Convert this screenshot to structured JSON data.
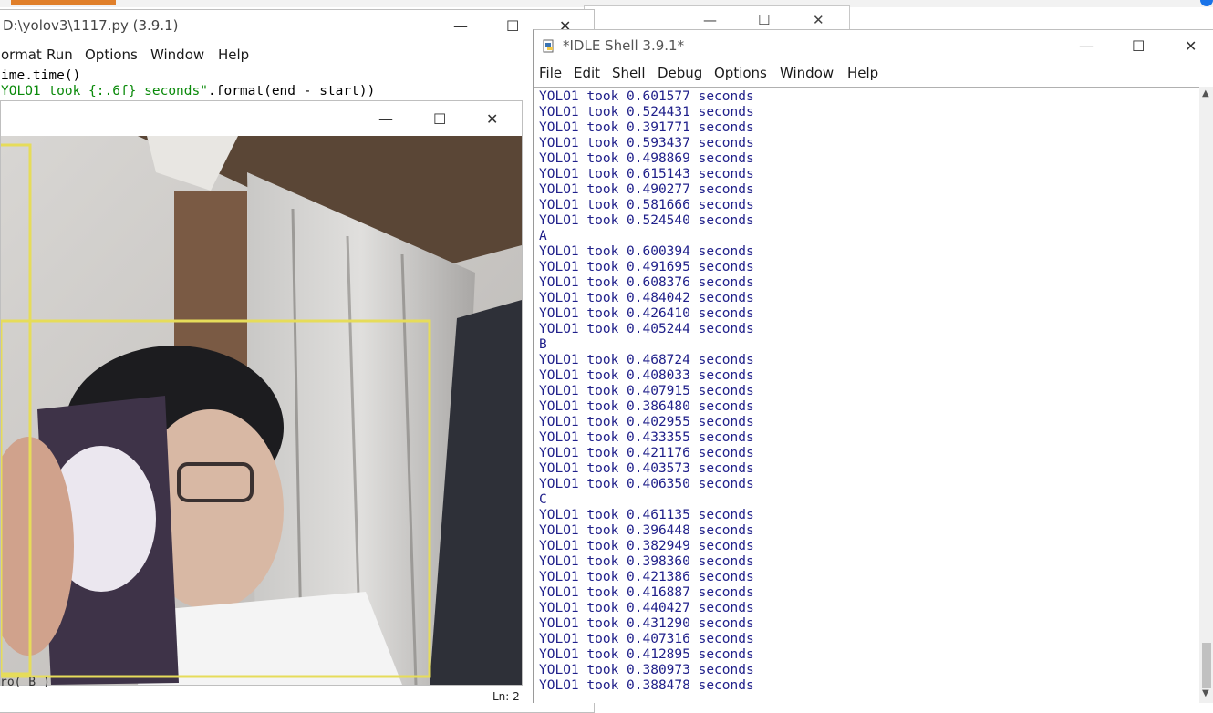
{
  "back_window": {
    "minimize": "—",
    "maximize": "☐",
    "close": "✕"
  },
  "editor": {
    "title": "D:\\yolov3\\1117.py (3.9.1)",
    "menu": [
      "ormat",
      "Run",
      "Options",
      "Window",
      "Help"
    ],
    "code_line1": "ime.time()",
    "code_line2_prefix": "YOLO1 took {:.6f} seconds\"",
    "code_line2_suffix": ".format(end - start))",
    "bottom_text": "ro( B )",
    "status": "Ln: 2"
  },
  "image_window": {
    "minimize": "—",
    "maximize": "☐",
    "close": "✕"
  },
  "shell": {
    "title": "*IDLE Shell 3.9.1*",
    "menu": [
      "File",
      "Edit",
      "Shell",
      "Debug",
      "Options",
      "Window",
      "Help"
    ],
    "lines": [
      "YOLO1 took 0.601577 seconds",
      "YOLO1 took 0.524431 seconds",
      "YOLO1 took 0.391771 seconds",
      "YOLO1 took 0.593437 seconds",
      "YOLO1 took 0.498869 seconds",
      "YOLO1 took 0.615143 seconds",
      "YOLO1 took 0.490277 seconds",
      "YOLO1 took 0.581666 seconds",
      "YOLO1 took 0.524540 seconds",
      "A",
      "YOLO1 took 0.600394 seconds",
      "YOLO1 took 0.491695 seconds",
      "YOLO1 took 0.608376 seconds",
      "YOLO1 took 0.484042 seconds",
      "YOLO1 took 0.426410 seconds",
      "YOLO1 took 0.405244 seconds",
      "B",
      "YOLO1 took 0.468724 seconds",
      "YOLO1 took 0.408033 seconds",
      "YOLO1 took 0.407915 seconds",
      "YOLO1 took 0.386480 seconds",
      "YOLO1 took 0.402955 seconds",
      "YOLO1 took 0.433355 seconds",
      "YOLO1 took 0.421176 seconds",
      "YOLO1 took 0.403573 seconds",
      "YOLO1 took 0.406350 seconds",
      "C",
      "YOLO1 took 0.461135 seconds",
      "YOLO1 took 0.396448 seconds",
      "YOLO1 took 0.382949 seconds",
      "YOLO1 took 0.398360 seconds",
      "YOLO1 took 0.421386 seconds",
      "YOLO1 took 0.416887 seconds",
      "YOLO1 took 0.440427 seconds",
      "YOLO1 took 0.431290 seconds",
      "YOLO1 took 0.407316 seconds",
      "YOLO1 took 0.412895 seconds",
      "YOLO1 took 0.380973 seconds",
      "YOLO1 took 0.388478 seconds"
    ]
  },
  "colors": {
    "shell_text": "#1f1f8a",
    "code_string": "#0a8a0a",
    "detection_box": "#e6dc5a"
  }
}
